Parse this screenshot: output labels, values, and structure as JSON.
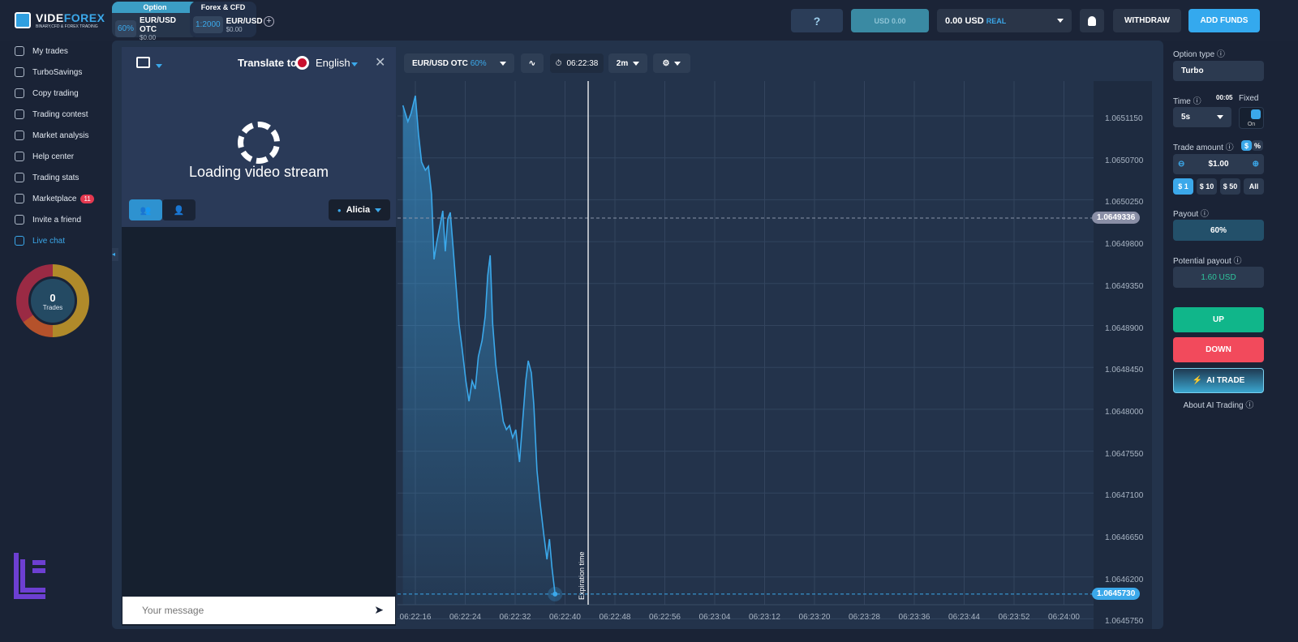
{
  "header": {
    "logo_brand_a": "VIDE",
    "logo_brand_b": "FOREX",
    "logo_tagline": "BINARY,CFD & FOREX TRADING",
    "tabs": [
      {
        "title": "Option",
        "badge": "60%",
        "name": "EUR/USD OTC",
        "amount": "$0.00"
      },
      {
        "title": "Forex & CFD",
        "badge": "1:2000",
        "name": "EUR/USD",
        "amount": "$0.00"
      }
    ],
    "add_tab": "+",
    "bonus_balance": "USD 0.00",
    "balance": "0.00 USD",
    "account_type": "REAL",
    "withdraw": "WITHDRAW",
    "add_funds": "ADD FUNDS"
  },
  "sidebar": {
    "items": [
      {
        "label": "My trades"
      },
      {
        "label": "TurboSavings"
      },
      {
        "label": "Copy trading"
      },
      {
        "label": "Trading contest"
      },
      {
        "label": "Market analysis"
      },
      {
        "label": "Help center"
      },
      {
        "label": "Trading stats"
      },
      {
        "label": "Marketplace",
        "badge": "11"
      },
      {
        "label": "Invite a friend"
      },
      {
        "label": "Live chat",
        "active": true
      }
    ],
    "trades_count": "0",
    "trades_label": "Trades"
  },
  "chat": {
    "translate_label": "Translate to:",
    "language": "English",
    "loading_text": "Loading video stream",
    "agent": "Alicia",
    "message_placeholder": "Your message"
  },
  "toolbar": {
    "asset": "EUR/USD OTC",
    "asset_payout": "60%",
    "clock": "06:22:38",
    "timeframe": "2m"
  },
  "right_panel": {
    "option_type_label": "Option type",
    "option_type": "Turbo",
    "time_label": "Time",
    "time_countdown": "00:05",
    "fixed_label": "Fixed",
    "time_value": "5s",
    "fixed_toggle": "On",
    "fixed_on": true,
    "trade_amount_label": "Trade amount",
    "currency_toggle": [
      "$",
      "%"
    ],
    "amount": "$1.00",
    "presets": [
      "$ 1",
      "$ 10",
      "$ 50",
      "All"
    ],
    "payout_label": "Payout",
    "payout": "60%",
    "potential_label": "Potential payout",
    "potential": "1.60 USD",
    "up": "UP",
    "down": "DOWN",
    "ai_trade": "AI TRADE",
    "about_ai": "About AI Trading",
    "colors": {
      "up": "#10b68a",
      "down": "#f24a5c",
      "accent": "#3ba8ea"
    }
  },
  "chart_data": {
    "type": "area",
    "x_ticks": [
      "06:22:16",
      "06:22:24",
      "06:22:32",
      "06:22:40",
      "06:22:48",
      "06:22:56",
      "06:23:04",
      "06:23:12",
      "06:23:20",
      "06:23:28",
      "06:23:36",
      "06:23:44",
      "06:23:52",
      "06:24:00"
    ],
    "y_ticks": [
      "1.0651150",
      "1.0650700",
      "1.0650250",
      "1.0649800",
      "1.0649350",
      "1.0648900",
      "1.0648450",
      "1.0648000",
      "1.0647550",
      "1.0647100",
      "1.0646650",
      "1.0646200",
      "1.0645750"
    ],
    "current_price": "1.0645730",
    "reference_price": "1.0649336",
    "expiration_label": "Expiration time",
    "grid": true,
    "color": "#3ba8ea",
    "points": [
      [
        "06:22:14.0",
        1.0651298
      ],
      [
        "06:22:14.8",
        1.0651124
      ],
      [
        "06:22:15.3",
        1.0651211
      ],
      [
        "06:22:16.0",
        1.0651402
      ],
      [
        "06:22:16.5",
        1.0650993
      ],
      [
        "06:22:17.0",
        1.0650689
      ],
      [
        "06:22:17.6",
        1.0650602
      ],
      [
        "06:22:18.1",
        1.0650645
      ],
      [
        "06:22:18.6",
        1.0650341
      ],
      [
        "06:22:19.0",
        1.0649644
      ],
      [
        "06:22:19.4",
        1.0649818
      ],
      [
        "06:22:19.9",
        1.0649992
      ],
      [
        "06:22:20.4",
        1.0650166
      ],
      [
        "06:22:20.8",
        1.0649731
      ],
      [
        "06:22:21.2",
        1.0650079
      ],
      [
        "06:22:21.6",
        1.0650149
      ],
      [
        "06:22:22.0",
        1.0649818
      ],
      [
        "06:22:22.5",
        1.0649383
      ],
      [
        "06:22:23.0",
        1.0648948
      ],
      [
        "06:22:23.5",
        1.0648687
      ],
      [
        "06:22:24.1",
        1.0648339
      ],
      [
        "06:22:24.6",
        1.0648121
      ],
      [
        "06:22:25.1",
        1.0648339
      ],
      [
        "06:22:25.6",
        1.0648252
      ],
      [
        "06:22:26.1",
        1.06486
      ],
      [
        "06:22:26.7",
        1.0648774
      ],
      [
        "06:22:27.2",
        1.0649035
      ],
      [
        "06:22:27.6",
        1.064947
      ],
      [
        "06:22:28.0",
        1.0649688
      ],
      [
        "06:22:28.4",
        1.0648948
      ],
      [
        "06:22:28.9",
        1.0648513
      ],
      [
        "06:22:29.4",
        1.0648252
      ],
      [
        "06:22:30.1",
        1.0647903
      ],
      [
        "06:22:30.6",
        1.0647816
      ],
      [
        "06:22:31.1",
        1.064786
      ],
      [
        "06:22:31.6",
        1.0647729
      ],
      [
        "06:22:32.1",
        1.0647816
      ],
      [
        "06:22:32.7",
        1.0647468
      ],
      [
        "06:22:33.2",
        1.0647903
      ],
      [
        "06:22:33.7",
        1.0648339
      ],
      [
        "06:22:34.1",
        1.0648556
      ],
      [
        "06:22:34.6",
        1.0648426
      ],
      [
        "06:22:35.0",
        1.0648078
      ],
      [
        "06:22:35.5",
        1.0647381
      ],
      [
        "06:22:36.0",
        1.0647033
      ],
      [
        "06:22:36.6",
        1.0646685
      ],
      [
        "06:22:37.1",
        1.0646424
      ],
      [
        "06:22:37.5",
        1.0646641
      ],
      [
        "06:22:37.9",
        1.0646337
      ],
      [
        "06:22:38.4",
        1.064605
      ]
    ]
  }
}
